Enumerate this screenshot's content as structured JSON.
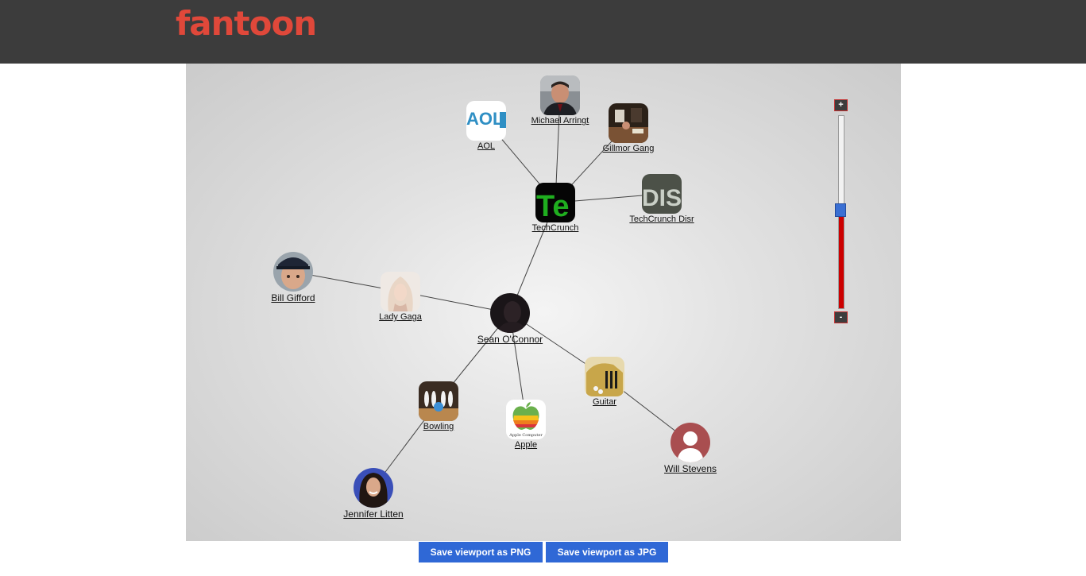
{
  "header": {
    "logo_text": "fantoon",
    "logo_color": "#e0483a",
    "bg_color": "#3c3c3c"
  },
  "graph": {
    "nodes": [
      {
        "id": "michael",
        "label": "Michael Arringt"
      },
      {
        "id": "aol",
        "label": "AOL"
      },
      {
        "id": "gillmor",
        "label": "Gillmor Gang"
      },
      {
        "id": "techcrunch",
        "label": "TechCrunch"
      },
      {
        "id": "disrupt",
        "label": "TechCrunch Disr"
      },
      {
        "id": "bill",
        "label": "Bill Gifford"
      },
      {
        "id": "gaga",
        "label": "Lady Gaga"
      },
      {
        "id": "sean",
        "label": "Sean O'Connor"
      },
      {
        "id": "guitar",
        "label": "Guitar"
      },
      {
        "id": "bowling",
        "label": "Bowling"
      },
      {
        "id": "apple",
        "label": "Apple"
      },
      {
        "id": "will",
        "label": "Will Stevens"
      },
      {
        "id": "jennifer",
        "label": "Jennifer Litten"
      }
    ],
    "avatar_text": {
      "aol": "AOL",
      "techcrunch": "Te",
      "disrupt": "DIS",
      "apple": "Apple Computer"
    }
  },
  "zoom": {
    "plus": "+",
    "minus": "-",
    "level_fraction": 0.47
  },
  "actions": {
    "save_png": "Save viewport as PNG",
    "save_jpg": "Save viewport as JPG"
  }
}
